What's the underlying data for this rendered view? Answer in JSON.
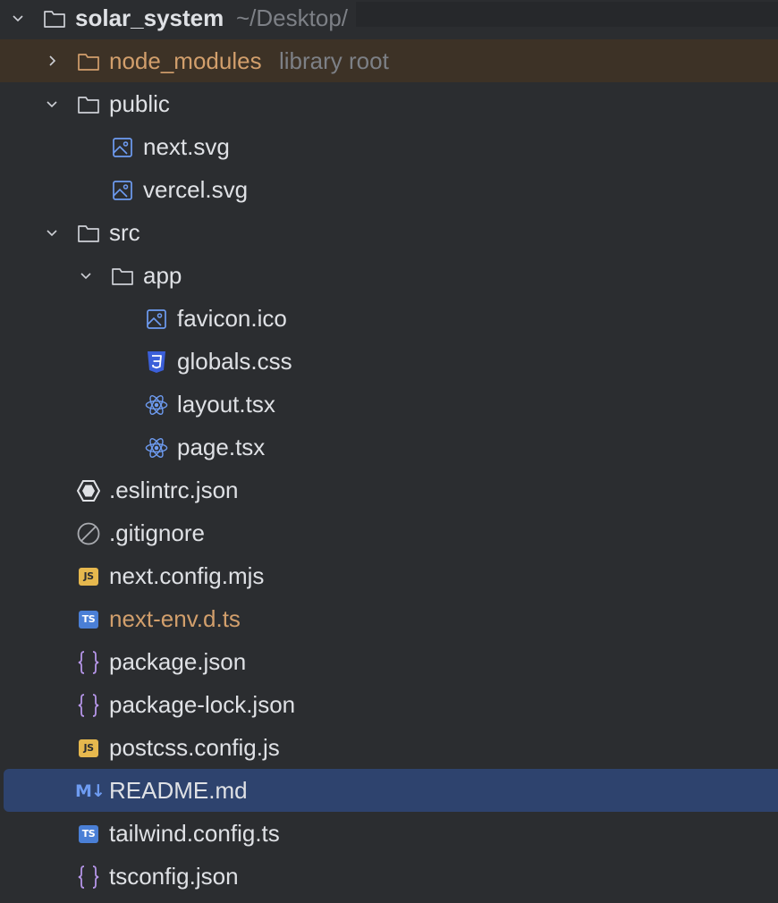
{
  "root": {
    "name": "solar_system",
    "path": "~/Desktop/"
  },
  "rows": [
    {
      "label": "node_modules",
      "hint": "library root"
    },
    {
      "label": "public"
    },
    {
      "label": "next.svg"
    },
    {
      "label": "vercel.svg"
    },
    {
      "label": "src"
    },
    {
      "label": "app"
    },
    {
      "label": "favicon.ico"
    },
    {
      "label": "globals.css"
    },
    {
      "label": "layout.tsx"
    },
    {
      "label": "page.tsx"
    },
    {
      "label": ".eslintrc.json"
    },
    {
      "label": ".gitignore"
    },
    {
      "label": "next.config.mjs",
      "badge": "JS"
    },
    {
      "label": "next-env.d.ts",
      "badge": "TS"
    },
    {
      "label": "package.json"
    },
    {
      "label": "package-lock.json"
    },
    {
      "label": "postcss.config.js",
      "badge": "JS"
    },
    {
      "label": "README.md",
      "badge": "M↓"
    },
    {
      "label": "tailwind.config.ts",
      "badge": "TS"
    },
    {
      "label": "tsconfig.json"
    }
  ],
  "icons": {
    "folder": "folder-icon",
    "image": "image-file-icon",
    "css": "css-file-icon",
    "react": "react-file-icon",
    "eslint": "eslint-icon",
    "ignore": "gitignore-icon",
    "json": "json-braces-icon"
  },
  "colors": {
    "background": "#2b2d30",
    "selection": "#2e436e",
    "excluded": "#3d3226",
    "text": "#dfe1e5",
    "muted": "#7d8086",
    "modified": "#d29f6c",
    "accent": "#6e9cf2",
    "purple": "#b595e8",
    "js": "#e6b84e",
    "ts": "#4a7fd6"
  }
}
